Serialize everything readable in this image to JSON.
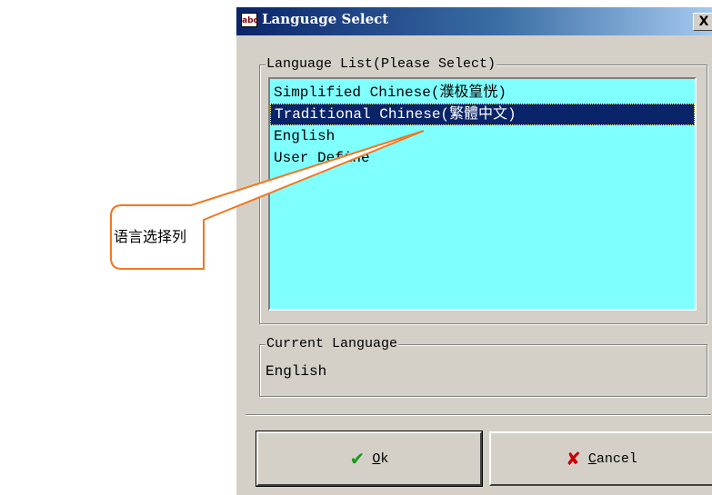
{
  "callout": {
    "text": "语言选择列"
  },
  "dialog": {
    "title": "Language Select",
    "icon_text": "abc",
    "close_label": "X",
    "language_group": {
      "legend": "Language List(Please Select)",
      "items": [
        {
          "label": "Simplified Chinese(濮极篁恍)"
        },
        {
          "label": "Traditional Chinese(繁體中文)"
        },
        {
          "label": "English"
        },
        {
          "label": "User Define"
        }
      ],
      "selected_index": 1
    },
    "current_group": {
      "legend": "Current Language",
      "value": "English"
    },
    "buttons": {
      "ok": {
        "mnemonic": "O",
        "rest": "k"
      },
      "cancel": {
        "mnemonic": "C",
        "rest": "ancel"
      }
    }
  },
  "colors": {
    "list_background": "#80ffff",
    "selection": "#0a246a",
    "callout_stroke": "#f07820",
    "title_gradient_start": "#0a246a"
  },
  "icons": [
    "app-icon",
    "close-icon",
    "check-icon",
    "x-icon"
  ]
}
